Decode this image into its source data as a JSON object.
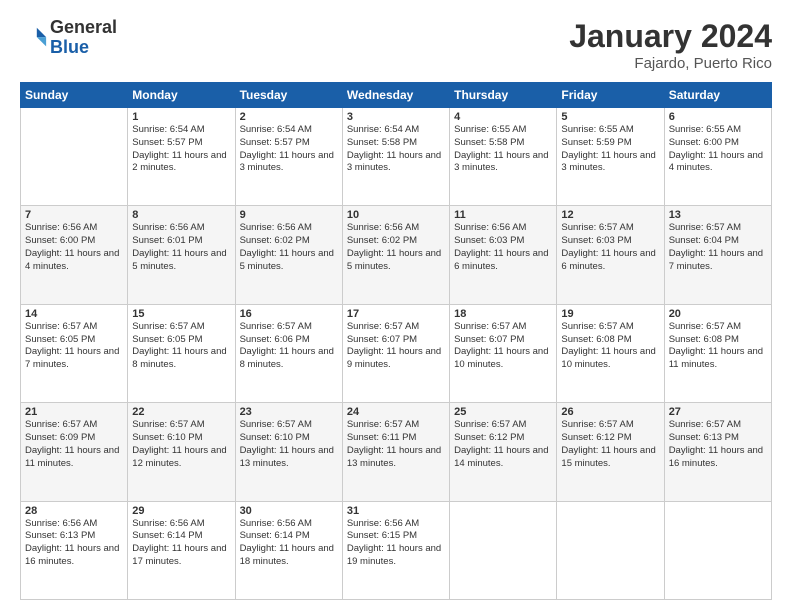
{
  "logo": {
    "general": "General",
    "blue": "Blue"
  },
  "header": {
    "title": "January 2024",
    "subtitle": "Fajardo, Puerto Rico"
  },
  "weekdays": [
    "Sunday",
    "Monday",
    "Tuesday",
    "Wednesday",
    "Thursday",
    "Friday",
    "Saturday"
  ],
  "weeks": [
    [
      {
        "day": "",
        "sunrise": "",
        "sunset": "",
        "daylight": ""
      },
      {
        "day": "1",
        "sunrise": "Sunrise: 6:54 AM",
        "sunset": "Sunset: 5:57 PM",
        "daylight": "Daylight: 11 hours and 2 minutes."
      },
      {
        "day": "2",
        "sunrise": "Sunrise: 6:54 AM",
        "sunset": "Sunset: 5:57 PM",
        "daylight": "Daylight: 11 hours and 3 minutes."
      },
      {
        "day": "3",
        "sunrise": "Sunrise: 6:54 AM",
        "sunset": "Sunset: 5:58 PM",
        "daylight": "Daylight: 11 hours and 3 minutes."
      },
      {
        "day": "4",
        "sunrise": "Sunrise: 6:55 AM",
        "sunset": "Sunset: 5:58 PM",
        "daylight": "Daylight: 11 hours and 3 minutes."
      },
      {
        "day": "5",
        "sunrise": "Sunrise: 6:55 AM",
        "sunset": "Sunset: 5:59 PM",
        "daylight": "Daylight: 11 hours and 3 minutes."
      },
      {
        "day": "6",
        "sunrise": "Sunrise: 6:55 AM",
        "sunset": "Sunset: 6:00 PM",
        "daylight": "Daylight: 11 hours and 4 minutes."
      }
    ],
    [
      {
        "day": "7",
        "sunrise": "Sunrise: 6:56 AM",
        "sunset": "Sunset: 6:00 PM",
        "daylight": "Daylight: 11 hours and 4 minutes."
      },
      {
        "day": "8",
        "sunrise": "Sunrise: 6:56 AM",
        "sunset": "Sunset: 6:01 PM",
        "daylight": "Daylight: 11 hours and 5 minutes."
      },
      {
        "day": "9",
        "sunrise": "Sunrise: 6:56 AM",
        "sunset": "Sunset: 6:02 PM",
        "daylight": "Daylight: 11 hours and 5 minutes."
      },
      {
        "day": "10",
        "sunrise": "Sunrise: 6:56 AM",
        "sunset": "Sunset: 6:02 PM",
        "daylight": "Daylight: 11 hours and 5 minutes."
      },
      {
        "day": "11",
        "sunrise": "Sunrise: 6:56 AM",
        "sunset": "Sunset: 6:03 PM",
        "daylight": "Daylight: 11 hours and 6 minutes."
      },
      {
        "day": "12",
        "sunrise": "Sunrise: 6:57 AM",
        "sunset": "Sunset: 6:03 PM",
        "daylight": "Daylight: 11 hours and 6 minutes."
      },
      {
        "day": "13",
        "sunrise": "Sunrise: 6:57 AM",
        "sunset": "Sunset: 6:04 PM",
        "daylight": "Daylight: 11 hours and 7 minutes."
      }
    ],
    [
      {
        "day": "14",
        "sunrise": "Sunrise: 6:57 AM",
        "sunset": "Sunset: 6:05 PM",
        "daylight": "Daylight: 11 hours and 7 minutes."
      },
      {
        "day": "15",
        "sunrise": "Sunrise: 6:57 AM",
        "sunset": "Sunset: 6:05 PM",
        "daylight": "Daylight: 11 hours and 8 minutes."
      },
      {
        "day": "16",
        "sunrise": "Sunrise: 6:57 AM",
        "sunset": "Sunset: 6:06 PM",
        "daylight": "Daylight: 11 hours and 8 minutes."
      },
      {
        "day": "17",
        "sunrise": "Sunrise: 6:57 AM",
        "sunset": "Sunset: 6:07 PM",
        "daylight": "Daylight: 11 hours and 9 minutes."
      },
      {
        "day": "18",
        "sunrise": "Sunrise: 6:57 AM",
        "sunset": "Sunset: 6:07 PM",
        "daylight": "Daylight: 11 hours and 10 minutes."
      },
      {
        "day": "19",
        "sunrise": "Sunrise: 6:57 AM",
        "sunset": "Sunset: 6:08 PM",
        "daylight": "Daylight: 11 hours and 10 minutes."
      },
      {
        "day": "20",
        "sunrise": "Sunrise: 6:57 AM",
        "sunset": "Sunset: 6:08 PM",
        "daylight": "Daylight: 11 hours and 11 minutes."
      }
    ],
    [
      {
        "day": "21",
        "sunrise": "Sunrise: 6:57 AM",
        "sunset": "Sunset: 6:09 PM",
        "daylight": "Daylight: 11 hours and 11 minutes."
      },
      {
        "day": "22",
        "sunrise": "Sunrise: 6:57 AM",
        "sunset": "Sunset: 6:10 PM",
        "daylight": "Daylight: 11 hours and 12 minutes."
      },
      {
        "day": "23",
        "sunrise": "Sunrise: 6:57 AM",
        "sunset": "Sunset: 6:10 PM",
        "daylight": "Daylight: 11 hours and 13 minutes."
      },
      {
        "day": "24",
        "sunrise": "Sunrise: 6:57 AM",
        "sunset": "Sunset: 6:11 PM",
        "daylight": "Daylight: 11 hours and 13 minutes."
      },
      {
        "day": "25",
        "sunrise": "Sunrise: 6:57 AM",
        "sunset": "Sunset: 6:12 PM",
        "daylight": "Daylight: 11 hours and 14 minutes."
      },
      {
        "day": "26",
        "sunrise": "Sunrise: 6:57 AM",
        "sunset": "Sunset: 6:12 PM",
        "daylight": "Daylight: 11 hours and 15 minutes."
      },
      {
        "day": "27",
        "sunrise": "Sunrise: 6:57 AM",
        "sunset": "Sunset: 6:13 PM",
        "daylight": "Daylight: 11 hours and 16 minutes."
      }
    ],
    [
      {
        "day": "28",
        "sunrise": "Sunrise: 6:56 AM",
        "sunset": "Sunset: 6:13 PM",
        "daylight": "Daylight: 11 hours and 16 minutes."
      },
      {
        "day": "29",
        "sunrise": "Sunrise: 6:56 AM",
        "sunset": "Sunset: 6:14 PM",
        "daylight": "Daylight: 11 hours and 17 minutes."
      },
      {
        "day": "30",
        "sunrise": "Sunrise: 6:56 AM",
        "sunset": "Sunset: 6:14 PM",
        "daylight": "Daylight: 11 hours and 18 minutes."
      },
      {
        "day": "31",
        "sunrise": "Sunrise: 6:56 AM",
        "sunset": "Sunset: 6:15 PM",
        "daylight": "Daylight: 11 hours and 19 minutes."
      },
      {
        "day": "",
        "sunrise": "",
        "sunset": "",
        "daylight": ""
      },
      {
        "day": "",
        "sunrise": "",
        "sunset": "",
        "daylight": ""
      },
      {
        "day": "",
        "sunrise": "",
        "sunset": "",
        "daylight": ""
      }
    ]
  ]
}
